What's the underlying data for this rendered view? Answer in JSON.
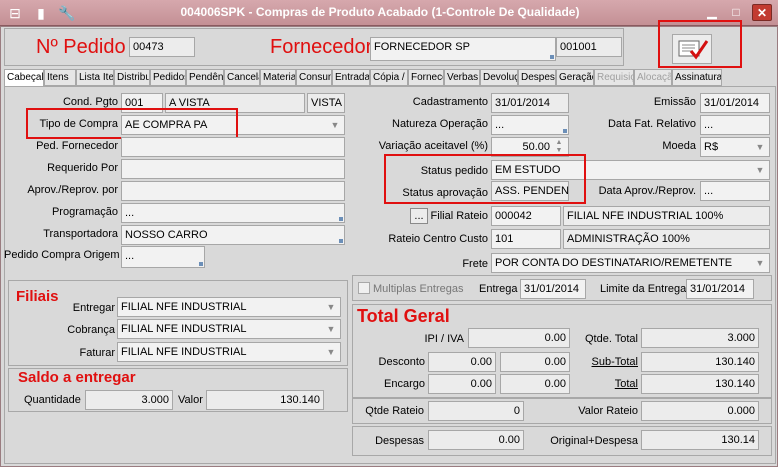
{
  "window": {
    "title": "004006SPK - Compras de Produto Acabado (1-Controle De Qualidade)"
  },
  "header": {
    "pedido_label": "Nº Pedido",
    "pedido_value": "00473",
    "fornecedor_label": "Fornecedor",
    "fornecedor_name": "FORNECEDOR SP",
    "fornecedor_code": "001001"
  },
  "tabs": [
    {
      "label": "Cabeçal",
      "state": "active"
    },
    {
      "label": "Itens"
    },
    {
      "label": "Lista Ite"
    },
    {
      "label": "Distribui"
    },
    {
      "label": "Pedidos"
    },
    {
      "label": "Pendênc"
    },
    {
      "label": "Cancelac"
    },
    {
      "label": "Materiai"
    },
    {
      "label": "Consum"
    },
    {
      "label": "Entradas"
    },
    {
      "label": "Cópia /"
    },
    {
      "label": "Fornece"
    },
    {
      "label": "Verbas"
    },
    {
      "label": "Devoluç"
    },
    {
      "label": "Despesa"
    },
    {
      "label": "Geração"
    },
    {
      "label": "Requisiç",
      "state": "disabled"
    },
    {
      "label": "Alocação",
      "state": "disabled"
    },
    {
      "label": "Assinaturas"
    }
  ],
  "left": {
    "cond_pgto_label": "Cond. Pgto",
    "cond_pgto_code": "001",
    "cond_pgto_desc": "A VISTA",
    "cond_pgto_extra": "VISTA",
    "tipo_compra_label": "Tipo de Compra",
    "tipo_compra_value": "AE COMPRA PA",
    "ped_fornecedor_label": "Ped. Fornecedor",
    "ped_fornecedor_value": "",
    "requerido_label": "Requerido Por",
    "requerido_value": "",
    "aprov_label": "Aprov./Reprov. por",
    "aprov_value": "",
    "programacao_label": "Programação",
    "programacao_value": "...",
    "transportadora_label": "Transportadora",
    "transportadora_value": "NOSSO CARRO",
    "pedido_origem_label": "Pedido Compra Origem",
    "pedido_origem_value": "..."
  },
  "right": {
    "cadastramento_label": "Cadastramento",
    "cadastramento_value": "31/01/2014",
    "emissao_label": "Emissão",
    "emissao_value": "31/01/2014",
    "natureza_label": "Natureza Operação",
    "natureza_value": "...",
    "data_fat_label": "Data Fat. Relativo",
    "data_fat_value": "...",
    "variacao_label": "Variação aceitavel (%)",
    "variacao_value": "50.00",
    "moeda_label": "Moeda",
    "moeda_value": "R$",
    "status_pedido_label": "Status pedido",
    "status_pedido_value": "EM ESTUDO",
    "status_aprov_label": "Status aprovação",
    "status_aprov_value": "ASS. PENDENTE",
    "data_aprov_label": "Data Aprov./Reprov.",
    "data_aprov_value": "...",
    "filial_rateio_button": "...",
    "filial_rateio_label": "Filial Rateio",
    "filial_rateio_code": "000042",
    "filial_rateio_desc": "FILIAL NFE INDUSTRIAL 100%",
    "rateio_cc_label": "Rateio Centro Custo",
    "rateio_cc_code": "101",
    "rateio_cc_desc": "ADMINISTRAÇÃO 100%",
    "frete_label": "Frete",
    "frete_value": "POR CONTA DO DESTINATARIO/REMETENTE"
  },
  "filiais": {
    "title": "Filiais",
    "entregar_label": "Entregar",
    "entregar_value": "FILIAL NFE INDUSTRIAL",
    "cobranca_label": "Cobrança",
    "cobranca_value": "FILIAL NFE INDUSTRIAL",
    "faturar_label": "Faturar",
    "faturar_value": "FILIAL NFE INDUSTRIAL"
  },
  "saldo": {
    "title": "Saldo a entregar",
    "quantidade_label": "Quantidade",
    "quantidade_value": "3.000",
    "valor_label": "Valor",
    "valor_value": "130.140"
  },
  "entrega": {
    "multiplas_label": "Multiplas Entregas",
    "multiplas_checked": false,
    "entrega_label": "Entrega",
    "entrega_value": "31/01/2014",
    "limite_label": "Limite da Entrega",
    "limite_value": "31/01/2014"
  },
  "total": {
    "title": "Total Geral",
    "ipi_label": "IPI / IVA",
    "ipi_value": "0.00",
    "qtde_total_label": "Qtde. Total",
    "qtde_total_value": "3.000",
    "desconto_label": "Desconto",
    "desconto_value1": "0.00",
    "desconto_value2": "0.00",
    "subtotal_label": "Sub-Total",
    "subtotal_value": "130.140",
    "encargo_label": "Encargo",
    "encargo_value1": "0.00",
    "encargo_value2": "0.00",
    "total_label": "Total",
    "total_value": "130.140",
    "qtde_rateio_label": "Qtde Rateio",
    "qtde_rateio_value": "0",
    "valor_rateio_label": "Valor Rateio",
    "valor_rateio_value": "0.000",
    "despesas_label": "Despesas",
    "despesas_value": "0.00",
    "original_label": "Original+Despesa",
    "original_value": "130.14"
  },
  "colors": {
    "accent_red": "#e01010",
    "title_bar": "#c49095",
    "panel": "#d9d9d9"
  }
}
